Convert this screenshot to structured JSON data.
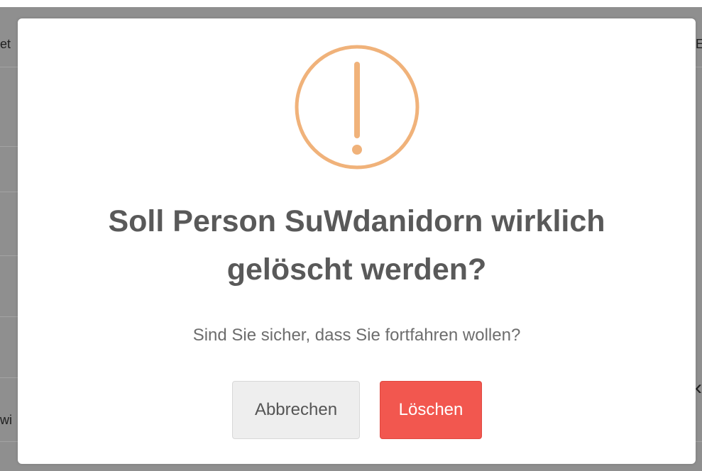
{
  "background": {
    "fragment_top_left": "et",
    "fragment_top_right": "E",
    "fragment_bottom_left": "wi",
    "chevron_icon": "chevron-left-icon"
  },
  "dialog": {
    "icon": "exclamation-circle-icon",
    "icon_color": "#f0b27a",
    "title_line1": "Soll Person SuWdanidorn wirklich",
    "title_line2": "gelöscht werden?",
    "text": "Sind Sie sicher, dass Sie fortfahren wollen?",
    "cancel_label": "Abbrechen",
    "confirm_label": "Löschen",
    "confirm_color": "#f2574f"
  }
}
